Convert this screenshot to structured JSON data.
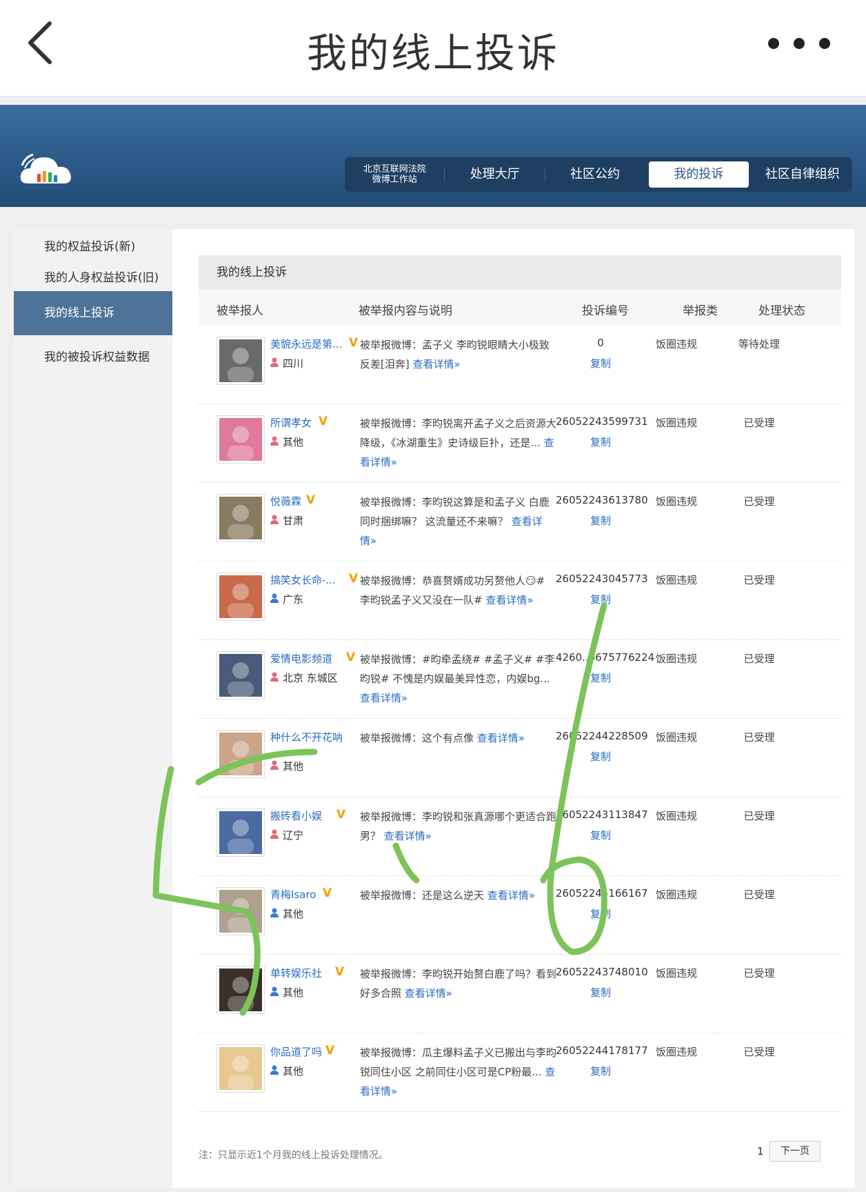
{
  "app_bar": {
    "title": "我的线上投诉"
  },
  "banner": {
    "nav": [
      {
        "label_line1": "北京互联网法院",
        "label_line2": "微博工作站"
      },
      {
        "label": "处理大厅"
      },
      {
        "label": "社区公约"
      },
      {
        "label": "我的投诉",
        "active": true
      },
      {
        "label": "社区自律组织"
      }
    ]
  },
  "sidebar": {
    "items": [
      {
        "label": "我的权益投诉(新)"
      },
      {
        "label": "我的人身权益投诉(旧)"
      },
      {
        "label": "我的线上投诉",
        "active": true
      },
      {
        "label": "我的被投诉权益数据"
      }
    ]
  },
  "content": {
    "title": "我的线上投诉",
    "columns": [
      "被举报人",
      "被举报内容与说明",
      "投诉编号",
      "举报类",
      "处理状态"
    ],
    "rows": [
      {
        "name": "美貌永远是第...",
        "region": "四川",
        "desc": "被举报微博：孟子义 李昀锐眼睛大小极致反差[泪奔]",
        "more": "查看详情»",
        "id": "0",
        "copy": "复制",
        "type": "饭圈违规",
        "status": "等待处理",
        "avatar_color": "#6a6a6a",
        "gender": "female"
      },
      {
        "name": "所谓孝女",
        "region": "其他",
        "desc": "被举报微博：李昀锐离开孟子义之后资源大降级，《冰湖重生》史诗级巨扑，还是...",
        "more": "查看详情»",
        "id": "26052243599731",
        "copy": "复制",
        "type": "饭圈违规",
        "status": "已受理",
        "avatar_color": "#e07a9a",
        "gender": "female"
      },
      {
        "name": "悦薇霖",
        "region": "甘肃",
        "desc": "被举报微博：李昀锐这算是和孟子义 白鹿同时捆绑嘛？ 这流量还不来嘛？",
        "more": "查看详情»",
        "id": "26052243613780",
        "copy": "复制",
        "type": "饭圈违规",
        "status": "已受理",
        "avatar_color": "#8a7a60",
        "gender": "female"
      },
      {
        "name": "搞笑女长命-...",
        "region": "广东",
        "desc": "被举报微博：恭喜赘婿成功另赘他人😏# 李昀锐孟子义又没在一队#",
        "more": "查看详情»",
        "id": "26052243045773",
        "copy": "复制",
        "type": "饭圈违规",
        "status": "已受理",
        "avatar_color": "#c86a4a",
        "gender": "male"
      },
      {
        "name": "爱情电影频道",
        "region": "北京 东城区",
        "desc": "被举报微博：#昀牵孟绕# #孟子义# #李昀锐# 不愧是内娱最美异性恋，内娱bg...",
        "more": "查看详情»",
        "id": "4260..0675776224",
        "copy": "复制",
        "type": "饭圈违规",
        "status": "已受理",
        "avatar_color": "#4a5a7a",
        "gender": "female"
      },
      {
        "name": "种什么不开花呐",
        "region": "其他",
        "desc": "被举报微博：这个有点像",
        "more": "查看详情»",
        "id": "26052244228509",
        "copy": "复制",
        "type": "饭圈违规",
        "status": "已受理",
        "avatar_color": "#c9a58a",
        "gender": "female"
      },
      {
        "name": "搬砖看小娱",
        "region": "辽宁",
        "desc": "被举报微博：李昀锐和张真源哪个更适合跑男？",
        "more": "查看详情»",
        "id": "26052243113847",
        "copy": "复制",
        "type": "饭圈违规",
        "status": "已受理",
        "avatar_color": "#4a6aa0",
        "gender": "female"
      },
      {
        "name": "青梅Isaro",
        "region": "其他",
        "desc": "被举报微博：还是这么逆天",
        "more": "查看详情»",
        "id": "26052245166167",
        "copy": "复制",
        "type": "饭圈违规",
        "status": "已受理",
        "avatar_color": "#b0a090",
        "gender": "male"
      },
      {
        "name": "单转娱乐社",
        "region": "其他",
        "desc": "被举报微博：李昀锐开始赘白鹿了吗？看到好多合照",
        "more": "查看详情»",
        "id": "26052243748010",
        "copy": "复制",
        "type": "饭圈违规",
        "status": "已受理",
        "avatar_color": "#3a3028",
        "gender": "male"
      },
      {
        "name": "你品道了吗",
        "region": "其他",
        "desc": "被举报微博：瓜主爆料孟子义已搬出与李昀锐同住小区 之前同住小区可是CP粉最...",
        "more": "查看详情»",
        "id": "26052244178177",
        "copy": "复制",
        "type": "饭圈违规",
        "status": "已受理",
        "avatar_color": "#e8c890",
        "gender": "male"
      }
    ],
    "footer_note": "注：只显示近1个月我的线上投诉处理情况。",
    "page": "1",
    "next_label": "下一页"
  },
  "colors": {
    "link": "#2a6bc2",
    "banner": "#2c5a88",
    "active_side": "#4e7399",
    "vip": "#f0a000",
    "scribble": "#7cc35a"
  }
}
